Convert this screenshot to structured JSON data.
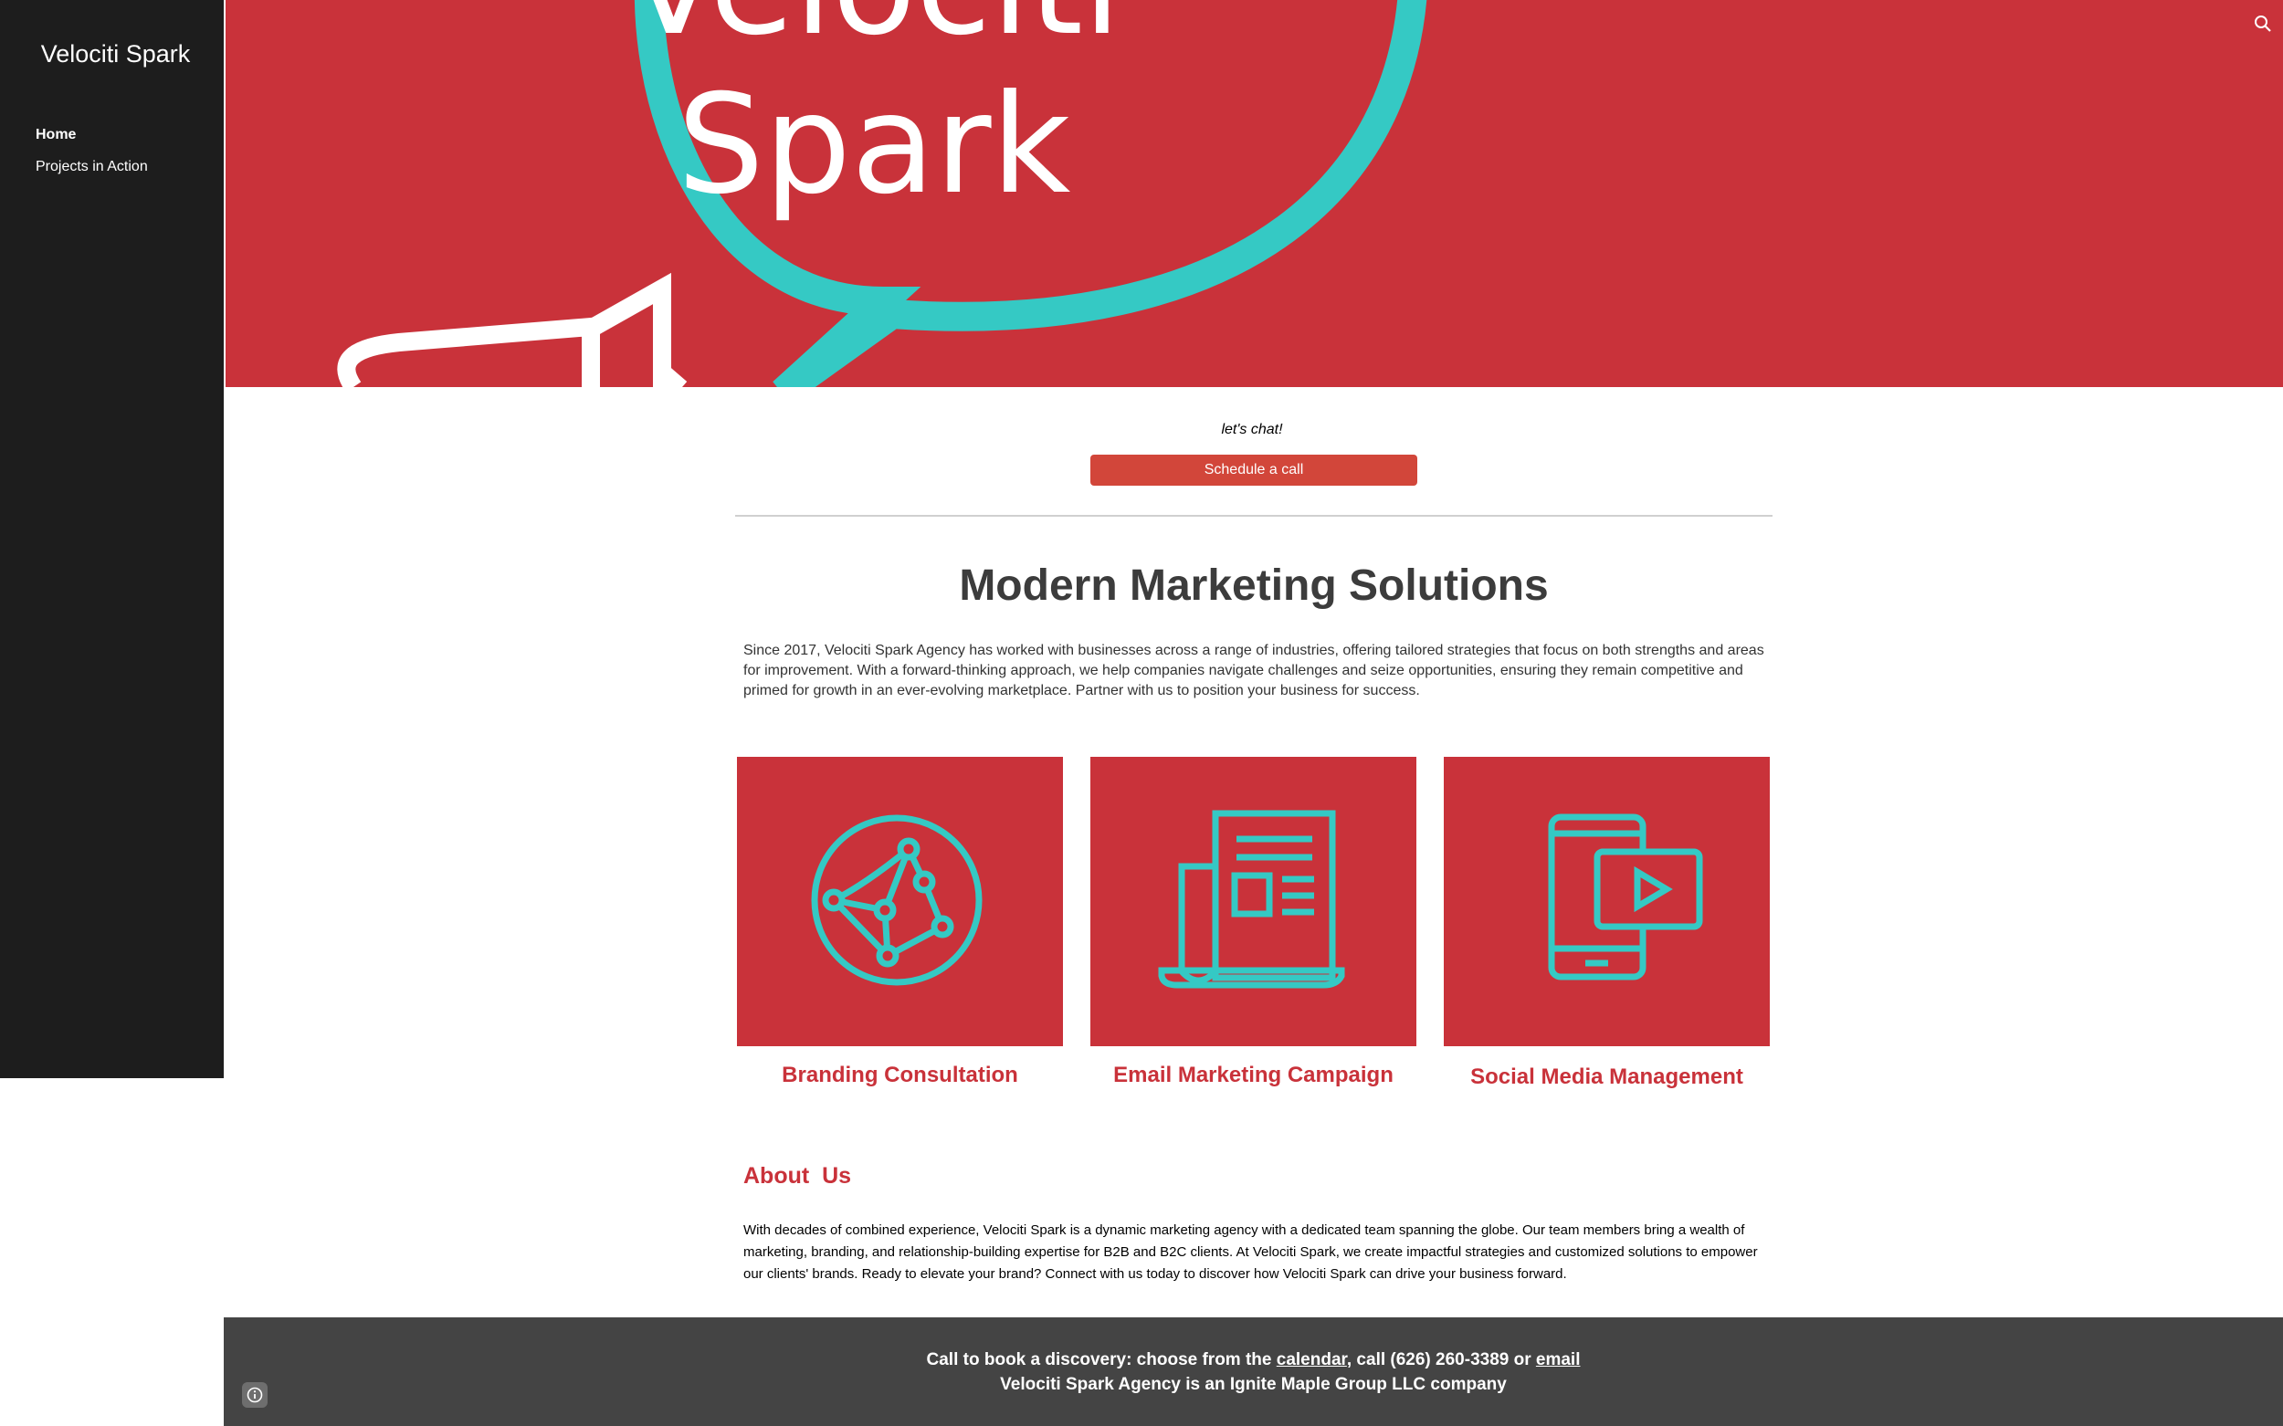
{
  "site": {
    "title": "Velociti Spark"
  },
  "nav": {
    "items": [
      {
        "label": "Home"
      },
      {
        "label": "Projects in Action"
      }
    ]
  },
  "hero": {
    "logo_line1": "Velociti",
    "logo_line2": "Spark"
  },
  "icons": {
    "search": "search-icon",
    "info": "info-icon"
  },
  "cta": {
    "text": "let's chat!",
    "button": "Schedule a call"
  },
  "main": {
    "headline": "Modern Marketing Solutions",
    "intro": "Since 2017, Velociti Spark Agency has worked with businesses across a range of industries, offering tailored strategies that focus on both strengths and areas for improvement. With a forward-thinking approach, we help companies navigate challenges and seize opportunities, ensuring they remain competitive and primed for growth in an ever-evolving marketplace. Partner with us to position your business for success."
  },
  "services": [
    {
      "title": "Branding Consultation",
      "icon": "globe-network-icon"
    },
    {
      "title": "Email Marketing Campaign",
      "icon": "newspaper-icon"
    },
    {
      "title": "Social Media Management",
      "icon": "phone-video-icon"
    }
  ],
  "about": {
    "heading": "About  Us",
    "body": "With decades of combined experience, Velociti Spark is a dynamic marketing agency with a dedicated team spanning the globe. Our team members bring a wealth of marketing, branding, and relationship-building expertise for B2B and B2C clients. At Velociti Spark, we create impactful strategies and customized solutions to empower our clients' brands. Ready to elevate your brand? Connect with us today to discover how Velociti Spark can drive your business forward."
  },
  "footer": {
    "prefix": "Call to book a discovery: choose from the ",
    "calendar_link": "calendar",
    "middle": ", call (626) 260-3389 or ",
    "email_link": "email",
    "line2": "Velociti Spark Agency is an Ignite Maple Group LLC company"
  },
  "colors": {
    "brand_red": "#c9323a",
    "teal": "#35c9c4",
    "button_red": "#d2463a",
    "sidebar": "#1d1d1d",
    "footer": "#444444"
  }
}
